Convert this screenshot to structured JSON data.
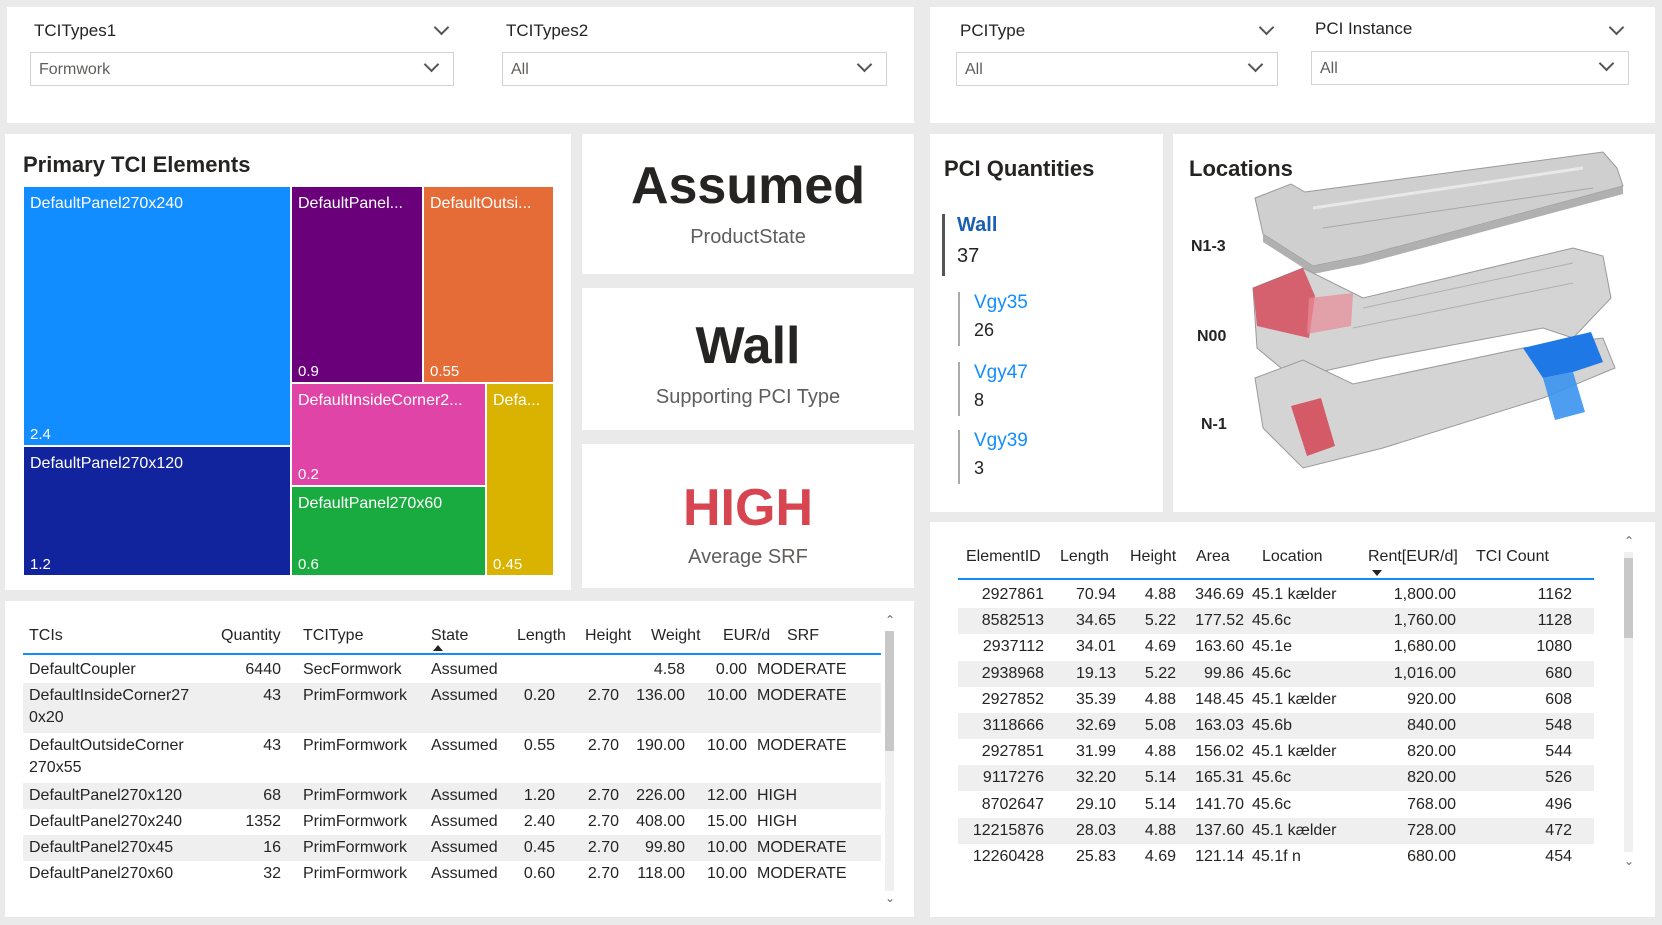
{
  "slicers": [
    {
      "title": "TCITypes1",
      "value": "Formwork"
    },
    {
      "title": "TCITypes2",
      "value": "All"
    },
    {
      "title": "PCIType",
      "value": "All"
    },
    {
      "title": "PCI Instance",
      "value": "All"
    }
  ],
  "treemap": {
    "title": "Primary TCI Elements",
    "cells": [
      {
        "label": "DefaultPanel270x240",
        "value": "2.4",
        "color": "#118dff"
      },
      {
        "label": "DefaultPanel270x120",
        "value": "1.2",
        "color": "#12239e"
      },
      {
        "label": "DefaultPanel...",
        "value": "0.9",
        "color": "#6b007b"
      },
      {
        "label": "DefaultOutsi...",
        "value": "0.55",
        "color": "#e66c37"
      },
      {
        "label": "DefaultInsideCorner2...",
        "value": "0.2",
        "color": "#e044a7"
      },
      {
        "label": "Defa...",
        "value": "0.45",
        "color": "#d9b300"
      },
      {
        "label": "DefaultPanel270x60",
        "value": "0.6",
        "color": "#1aab40"
      }
    ]
  },
  "cards": [
    {
      "value": "Assumed",
      "label": "ProductState",
      "color": "#252423"
    },
    {
      "value": "Wall",
      "label": "Supporting PCI Type",
      "color": "#252423"
    },
    {
      "value": "HIGH",
      "label": "Average SRF",
      "color": "#d64550"
    }
  ],
  "pci": {
    "title": "PCI Quantities",
    "main": {
      "name": "Wall",
      "value": "37"
    },
    "items": [
      {
        "name": "Vgy35",
        "value": "26"
      },
      {
        "name": "Vgy47",
        "value": "8"
      },
      {
        "name": "Vgy39",
        "value": "3"
      }
    ]
  },
  "locations": {
    "title": "Locations",
    "levels": [
      "N1-3",
      "N00",
      "N-1"
    ]
  },
  "tci_table": {
    "headers": [
      "TCIs",
      "Quantity",
      "TCIType",
      "State",
      "Length",
      "Height",
      "Weight",
      "EUR/d",
      "SRF"
    ],
    "rows": [
      {
        "tci": "DefaultCoupler",
        "tci2": "",
        "qty": "6440",
        "type": "SecFormwork",
        "state": "Assumed",
        "length": "",
        "height": "",
        "weight": "4.58",
        "eur": "0.00",
        "srf": "MODERATE"
      },
      {
        "tci": "DefaultInsideCorner27",
        "tci2": "0x20",
        "qty": "43",
        "type": "PrimFormwork",
        "state": "Assumed",
        "length": "0.20",
        "height": "2.70",
        "weight": "136.00",
        "eur": "10.00",
        "srf": "MODERATE"
      },
      {
        "tci": "DefaultOutsideCorner",
        "tci2": "270x55",
        "qty": "43",
        "type": "PrimFormwork",
        "state": "Assumed",
        "length": "0.55",
        "height": "2.70",
        "weight": "190.00",
        "eur": "10.00",
        "srf": "MODERATE"
      },
      {
        "tci": "DefaultPanel270x120",
        "tci2": "",
        "qty": "68",
        "type": "PrimFormwork",
        "state": "Assumed",
        "length": "1.20",
        "height": "2.70",
        "weight": "226.00",
        "eur": "12.00",
        "srf": "HIGH"
      },
      {
        "tci": "DefaultPanel270x240",
        "tci2": "",
        "qty": "1352",
        "type": "PrimFormwork",
        "state": "Assumed",
        "length": "2.40",
        "height": "2.70",
        "weight": "408.00",
        "eur": "15.00",
        "srf": "HIGH"
      },
      {
        "tci": "DefaultPanel270x45",
        "tci2": "",
        "qty": "16",
        "type": "PrimFormwork",
        "state": "Assumed",
        "length": "0.45",
        "height": "2.70",
        "weight": "99.80",
        "eur": "10.00",
        "srf": "MODERATE"
      },
      {
        "tci": "DefaultPanel270x60",
        "tci2": "",
        "qty": "32",
        "type": "PrimFormwork",
        "state": "Assumed",
        "length": "0.60",
        "height": "2.70",
        "weight": "118.00",
        "eur": "10.00",
        "srf": "MODERATE"
      }
    ]
  },
  "element_table": {
    "headers": [
      "ElementID",
      "Length",
      "Height",
      "Area",
      "Location",
      "Rent[EUR/d]",
      "TCI Count"
    ],
    "rows": [
      {
        "id": "2927861",
        "length": "70.94",
        "height": "4.88",
        "area": "346.69",
        "loc": "45.1 kælder",
        "rent": "1,800.00",
        "count": "1162"
      },
      {
        "id": "8582513",
        "length": "34.65",
        "height": "5.22",
        "area": "177.52",
        "loc": "45.6c",
        "rent": "1,760.00",
        "count": "1128"
      },
      {
        "id": "2937112",
        "length": "34.01",
        "height": "4.69",
        "area": "163.60",
        "loc": "45.1e",
        "rent": "1,680.00",
        "count": "1080"
      },
      {
        "id": "2938968",
        "length": "19.13",
        "height": "5.22",
        "area": "99.86",
        "loc": "45.6c",
        "rent": "1,016.00",
        "count": "680"
      },
      {
        "id": "2927852",
        "length": "35.39",
        "height": "4.88",
        "area": "148.45",
        "loc": "45.1 kælder",
        "rent": "920.00",
        "count": "608"
      },
      {
        "id": "3118666",
        "length": "32.69",
        "height": "5.08",
        "area": "163.03",
        "loc": "45.6b",
        "rent": "840.00",
        "count": "548"
      },
      {
        "id": "2927851",
        "length": "31.99",
        "height": "4.88",
        "area": "156.02",
        "loc": "45.1 kælder",
        "rent": "820.00",
        "count": "544"
      },
      {
        "id": "9117276",
        "length": "32.20",
        "height": "5.14",
        "area": "165.31",
        "loc": "45.6c",
        "rent": "820.00",
        "count": "526"
      },
      {
        "id": "8702647",
        "length": "29.10",
        "height": "5.14",
        "area": "141.70",
        "loc": "45.6c",
        "rent": "768.00",
        "count": "496"
      },
      {
        "id": "12215876",
        "length": "28.03",
        "height": "4.88",
        "area": "137.60",
        "loc": "45.1 kælder",
        "rent": "728.00",
        "count": "472"
      },
      {
        "id": "12260428",
        "length": "25.83",
        "height": "4.69",
        "area": "121.14",
        "loc": "45.1f n",
        "rent": "680.00",
        "count": "454"
      }
    ]
  }
}
